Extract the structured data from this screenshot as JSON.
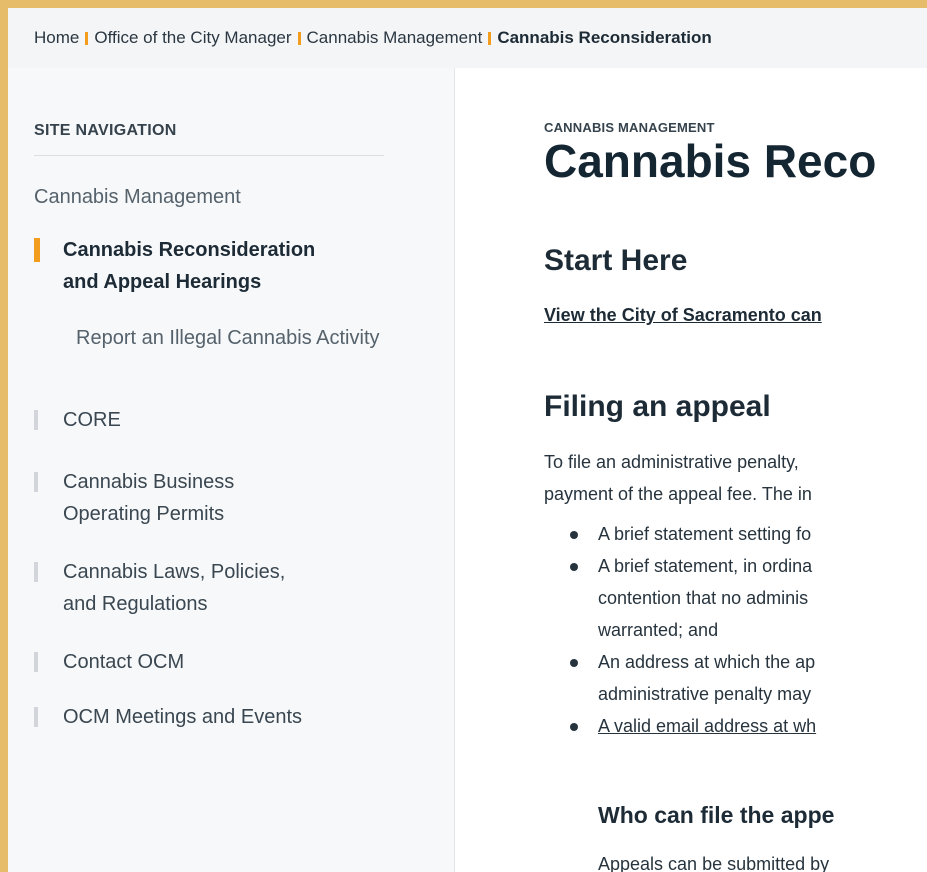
{
  "breadcrumb": {
    "items": [
      "Home",
      "Office of the City Manager",
      "Cannabis Management"
    ],
    "current": "Cannabis Reconsideration"
  },
  "sidebar": {
    "heading": "SITE NAVIGATION",
    "parent": "Cannabis Management",
    "active_item": [
      "Cannabis Reconsideration",
      "and Appeal Hearings"
    ],
    "sub_item": "Report an Illegal Cannabis Activity",
    "items": [
      [
        "CORE"
      ],
      [
        "Cannabis Business",
        "Operating Permits"
      ],
      [
        "Cannabis Laws, Policies,",
        "and Regulations"
      ],
      [
        "Contact OCM"
      ],
      [
        "OCM Meetings and Events"
      ]
    ]
  },
  "main": {
    "eyebrow": "CANNABIS MANAGEMENT",
    "title": "Cannabis Reco",
    "start_heading": "Start Here",
    "start_link": "View the City of Sacramento can",
    "filing_heading": "Filing an appeal",
    "filing_para": [
      "To file an administrative penalty,",
      "payment of the appeal fee. The in"
    ],
    "bullets": [
      [
        "A brief statement setting fo"
      ],
      [
        "A brief statement, in ordina",
        "contention that no adminis",
        "warranted; and"
      ],
      [
        "An address at which the ap",
        "administrative penalty may"
      ],
      [
        "A valid email address at wh"
      ]
    ],
    "who_heading": "Who can file the appe",
    "who_text": "Appeals can be submitted by"
  },
  "colors": {
    "accent": "#f29d1e",
    "frame": "#e6bb6a",
    "heading": "#152633"
  }
}
